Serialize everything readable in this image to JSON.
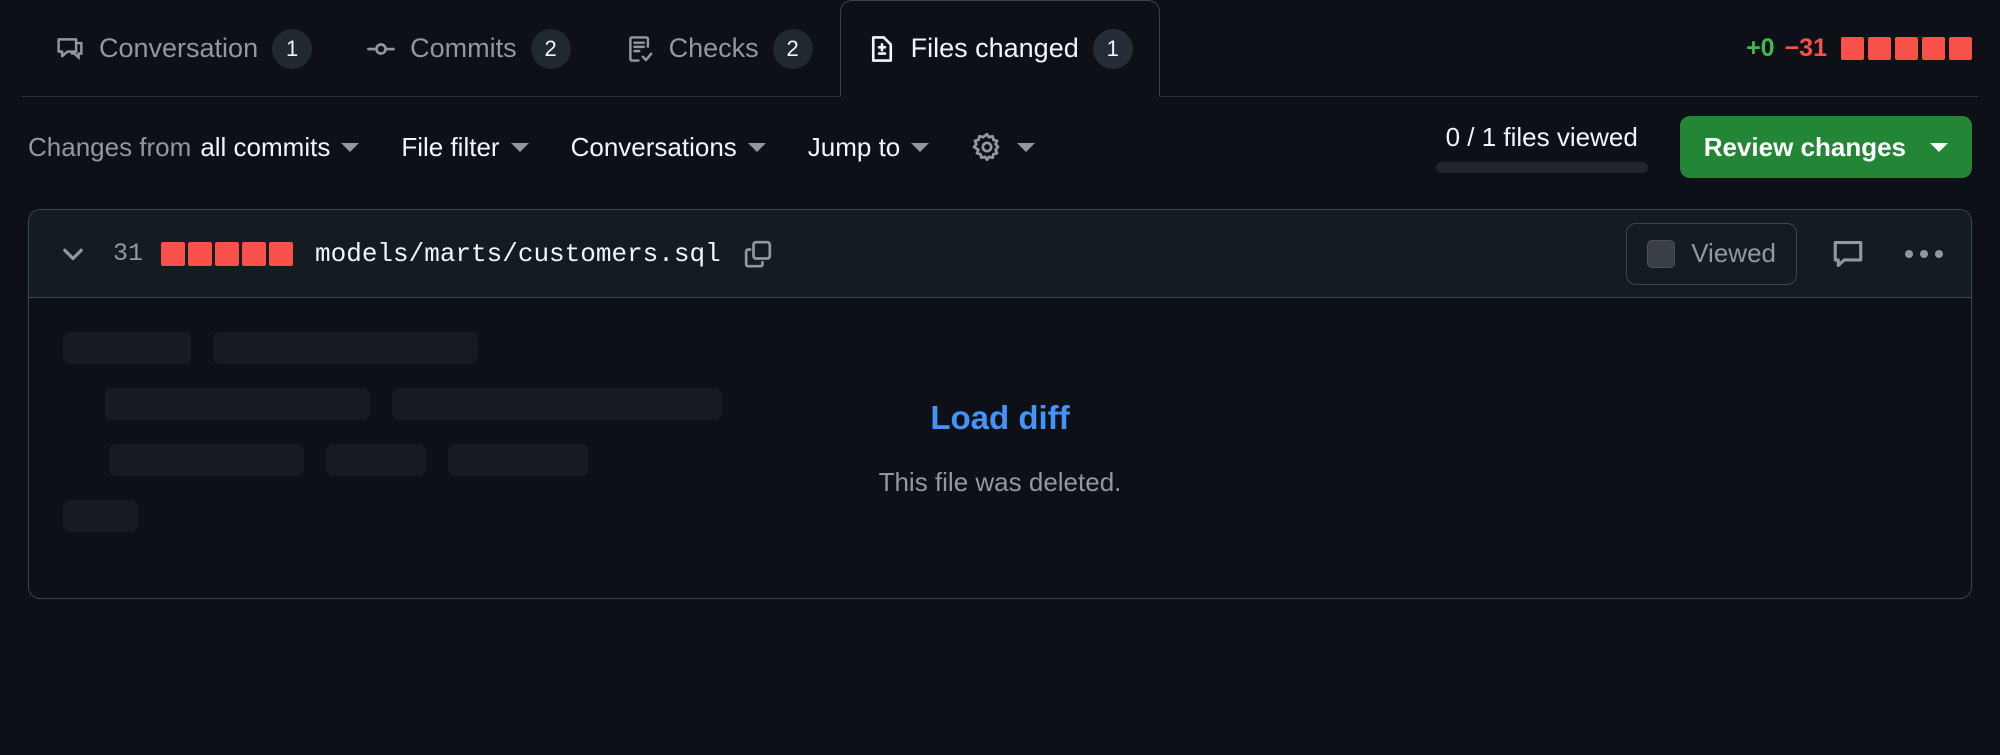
{
  "tabs": [
    {
      "id": "conversation",
      "label": "Conversation",
      "count": "1",
      "icon": "comment-discussion-icon",
      "active": false
    },
    {
      "id": "commits",
      "label": "Commits",
      "count": "2",
      "icon": "git-commit-icon",
      "active": false
    },
    {
      "id": "checks",
      "label": "Checks",
      "count": "2",
      "icon": "checklist-icon",
      "active": false
    },
    {
      "id": "files-changed",
      "label": "Files changed",
      "count": "1",
      "icon": "file-diff-icon",
      "active": true
    }
  ],
  "diffstat": {
    "additions": "+0",
    "deletions": "−31",
    "blocks": 5,
    "added_color": "#3fb950",
    "deleted_color": "#f85149"
  },
  "toolbar": {
    "changes_from_prefix": "Changes from",
    "changes_from_value": "all commits",
    "file_filter": "File filter",
    "conversations": "Conversations",
    "jump_to": "Jump to",
    "settings_icon": "gear-icon",
    "viewed_progress_text": "0 / 1 files viewed",
    "progress_percent": 0,
    "review_changes_label": "Review changes",
    "review_button_color": "#238636"
  },
  "file": {
    "deleted_lines": "31",
    "stat_blocks": 5,
    "path": "models/marts/customers.sql",
    "copy_icon": "copy-icon",
    "expand_icon": "chevron-down-icon",
    "viewed_label": "Viewed",
    "viewed_checked": false,
    "comment_icon": "comment-icon",
    "menu_icon": "kebab-horizontal-icon",
    "load_diff_label": "Load diff",
    "deleted_message": "This file was deleted.",
    "load_diff_color": "#4493f8"
  },
  "skeleton_rows": [
    [
      128,
      265
    ],
    [
      265,
      330
    ],
    [
      195,
      100,
      140
    ],
    [
      75
    ]
  ]
}
